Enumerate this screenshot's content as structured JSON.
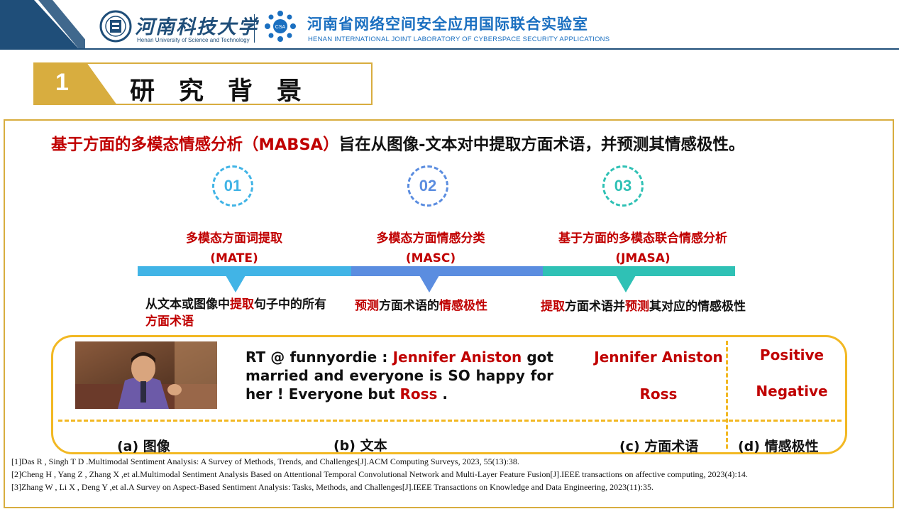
{
  "header": {
    "university_name_cn": "河南科技大学",
    "university_name_en": "Henan University of Science and Technology",
    "lab_name_cn": "河南省网络空间安全应用国际联合实验室",
    "lab_name_en": "HENAN INTERNATIONAL JOINT LABORATORY OF CYBERSPACE SECURITY APPLICATIONS",
    "lab_logo_text": "CSA"
  },
  "section": {
    "number": "1",
    "title": "研究背景"
  },
  "headline": {
    "highlight": "基于方面的多模态情感分析（MABSA）",
    "rest": "旨在从图像-文本对中提取方面术语，并预测其情感极性。"
  },
  "steps": [
    {
      "number": "01",
      "title": "多模态方面词提取",
      "abbr": "(MATE)",
      "color": "#41b4e6",
      "desc_parts": [
        "从文本或图像中",
        "提取",
        "句子中的所有",
        "方面术语"
      ]
    },
    {
      "number": "02",
      "title": "多模态方面情感分类",
      "abbr": "(MASC)",
      "color": "#5b8de0",
      "desc_parts": [
        "预测",
        "方面术语的",
        "情感极性"
      ]
    },
    {
      "number": "03",
      "title": "基于方面的多模态联合情感分析",
      "abbr": "(JMASA)",
      "color": "#2fc1b5",
      "desc_parts": [
        "提取",
        "方面术语并",
        "预测",
        "其对应的情感极性"
      ]
    }
  ],
  "example": {
    "tweet_parts": [
      "RT @ funnyordie : ",
      "Jennifer Aniston",
      " got married and everyone is SO happy for her ! Everyone but ",
      "Ross",
      " ."
    ],
    "aspects": [
      "Jennifer Aniston",
      "Ross"
    ],
    "polarities": [
      "Positive",
      "Negative"
    ],
    "captions": {
      "image": "(a)  图像",
      "text": "(b)  文本",
      "aspect": "(c)  方面术语",
      "polarity": "(d)  情感极性"
    }
  },
  "references": [
    "[1]Das R , Singh T D .Multimodal Sentiment Analysis: A Survey of Methods, Trends, and Challenges[J].ACM Computing Surveys, 2023, 55(13):38.",
    "[2]Cheng H , Yang Z , Zhang X ,et al.Multimodal Sentiment Analysis Based on Attentional Temporal Convolutional Network and Multi-Layer Feature Fusion[J].IEEE transactions on affective computing, 2023(4):14.",
    "[3]Zhang W , Li X , Deng Y ,et al.A Survey on Aspect-Based Sentiment Analysis: Tasks, Methods, and Challenges[J].IEEE Transactions on Knowledge and Data Engineering, 2023(11):35."
  ],
  "colors": {
    "accent_gold": "#d8ad3f",
    "accent_red": "#c00000",
    "brand_blue": "#1f4e79"
  }
}
